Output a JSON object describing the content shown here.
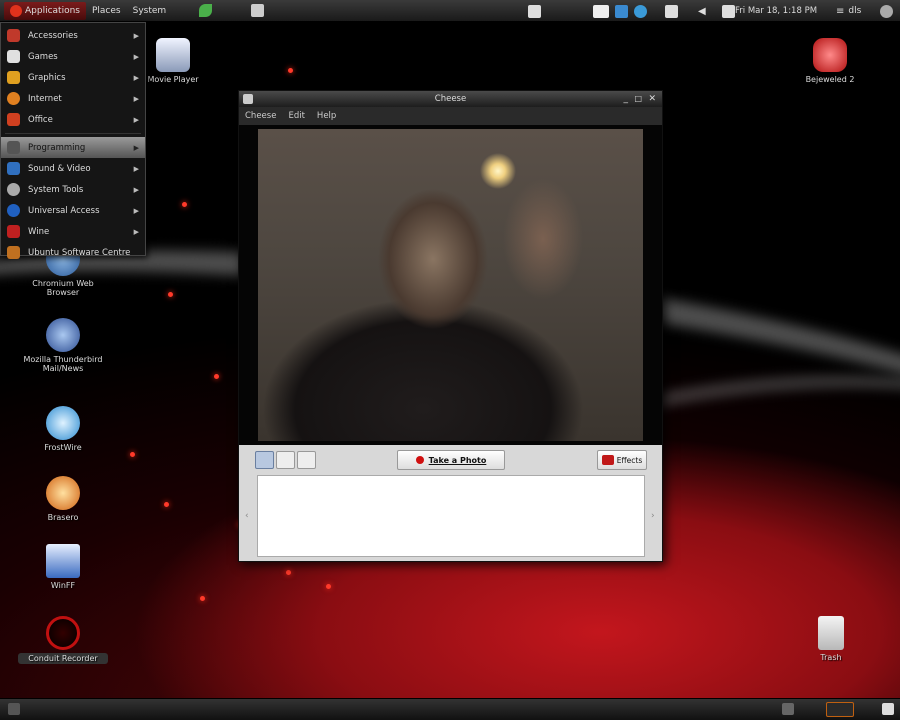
{
  "top_panel": {
    "menus": [
      "Applications",
      "Places",
      "System"
    ],
    "clock": "Fri Mar 18,  1:18 PM",
    "user": "dls"
  },
  "apps_menu": {
    "items": [
      {
        "label": "Accessories",
        "color": "#c0392b"
      },
      {
        "label": "Games",
        "color": "#e0e0e0"
      },
      {
        "label": "Graphics",
        "color": "#e0a020"
      },
      {
        "label": "Internet",
        "color": "#e08020"
      },
      {
        "label": "Office",
        "color": "#d04020"
      },
      {
        "label": "Programming",
        "color": "#888888"
      },
      {
        "label": "Sound & Video",
        "color": "#3070c0"
      },
      {
        "label": "System Tools",
        "color": "#aaaaaa"
      },
      {
        "label": "Universal Access",
        "color": "#2060c0"
      },
      {
        "label": "Wine",
        "color": "#c02020"
      },
      {
        "label": "Ubuntu Software Centre",
        "color": "#c07020"
      }
    ],
    "active_index": 5
  },
  "desktop_icons": [
    {
      "label": "Movie Player",
      "color": "#c8d0e0"
    },
    {
      "label": "Bejeweled 2",
      "color": "#d82a2a"
    },
    {
      "label": "Chromium Web Browser",
      "color": "#4a7ab0"
    },
    {
      "label": "Mozilla Thunderbird Mail/News",
      "color": "#3a6ab0"
    },
    {
      "label": "FrostWire",
      "color": "#3aa0e0"
    },
    {
      "label": "Brasero",
      "color": "#e08020"
    },
    {
      "label": "WinFF",
      "color": "#2a6ac0"
    },
    {
      "label": "Conduit Recorder",
      "color": "#c01010"
    },
    {
      "label": "Trash",
      "color": "#e0e0e0"
    }
  ],
  "cheese": {
    "title": "Cheese",
    "menus": [
      "Cheese",
      "Edit",
      "Help"
    ],
    "take_photo": "Take a Photo",
    "effects": "Effects"
  }
}
